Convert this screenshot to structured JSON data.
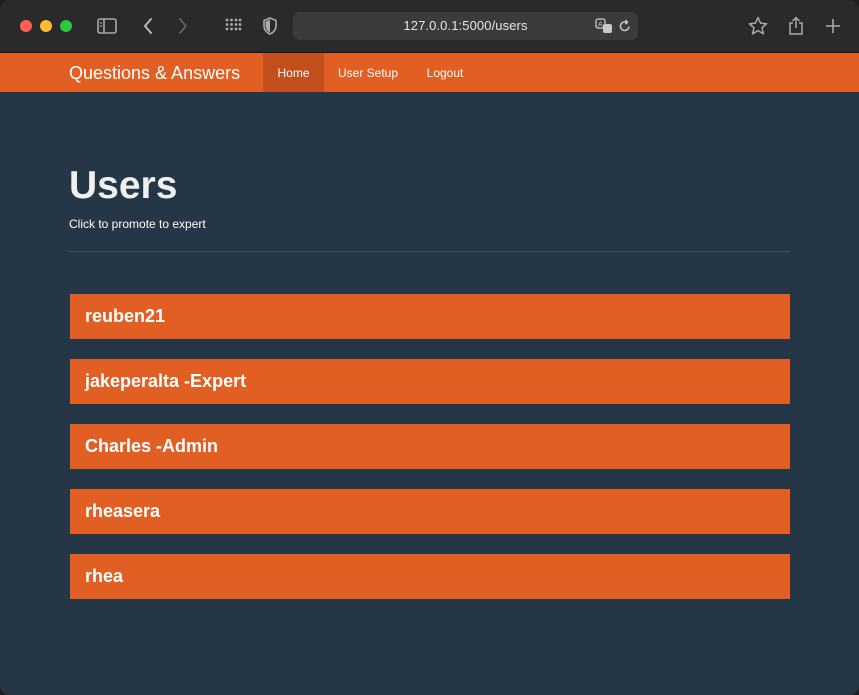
{
  "browser": {
    "url": "127.0.0.1:5000/users",
    "icons": [
      "sidebar-icon",
      "back-icon",
      "forward-icon",
      "grid-icon",
      "shield-icon",
      "translate-icon",
      "reload-icon",
      "star-icon",
      "share-icon",
      "new-tab-icon"
    ]
  },
  "navbar": {
    "brand": "Questions & Answers",
    "items": [
      {
        "label": "Home",
        "active": true
      },
      {
        "label": "User Setup",
        "active": false
      },
      {
        "label": "Logout",
        "active": false
      }
    ],
    "color": "#e25f24",
    "active_color": "#c34f1c"
  },
  "main": {
    "title": "Users",
    "subtitle": "Click to promote to expert",
    "users": [
      {
        "label": "reuben21"
      },
      {
        "label": "jakeperalta -Expert"
      },
      {
        "label": "Charles -Admin"
      },
      {
        "label": "rheasera"
      },
      {
        "label": "rhea"
      }
    ],
    "background": "#253747"
  }
}
